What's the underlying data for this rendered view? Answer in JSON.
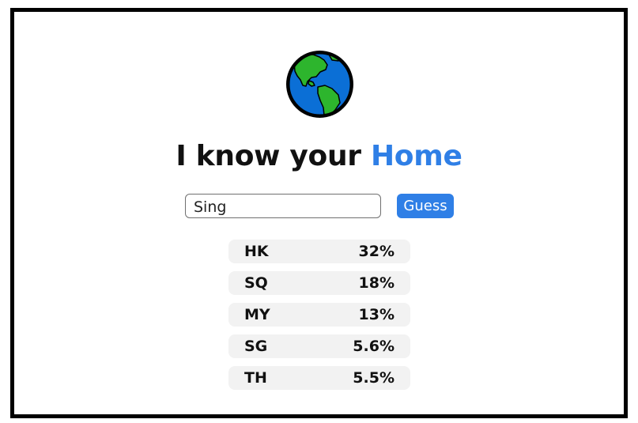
{
  "header": {
    "logo_icon": "globe-americas-icon",
    "title_prefix": "I know your",
    "title_accent": "Home",
    "accent_color": "#2f7fe6"
  },
  "search": {
    "value": "Sing",
    "button_label": "Guess"
  },
  "results": [
    {
      "code": "HK",
      "percent": "32%"
    },
    {
      "code": "SQ",
      "percent": "18%"
    },
    {
      "code": "MY",
      "percent": "13%"
    },
    {
      "code": "SG",
      "percent": "5.6%"
    },
    {
      "code": "TH",
      "percent": "5.5%"
    }
  ]
}
